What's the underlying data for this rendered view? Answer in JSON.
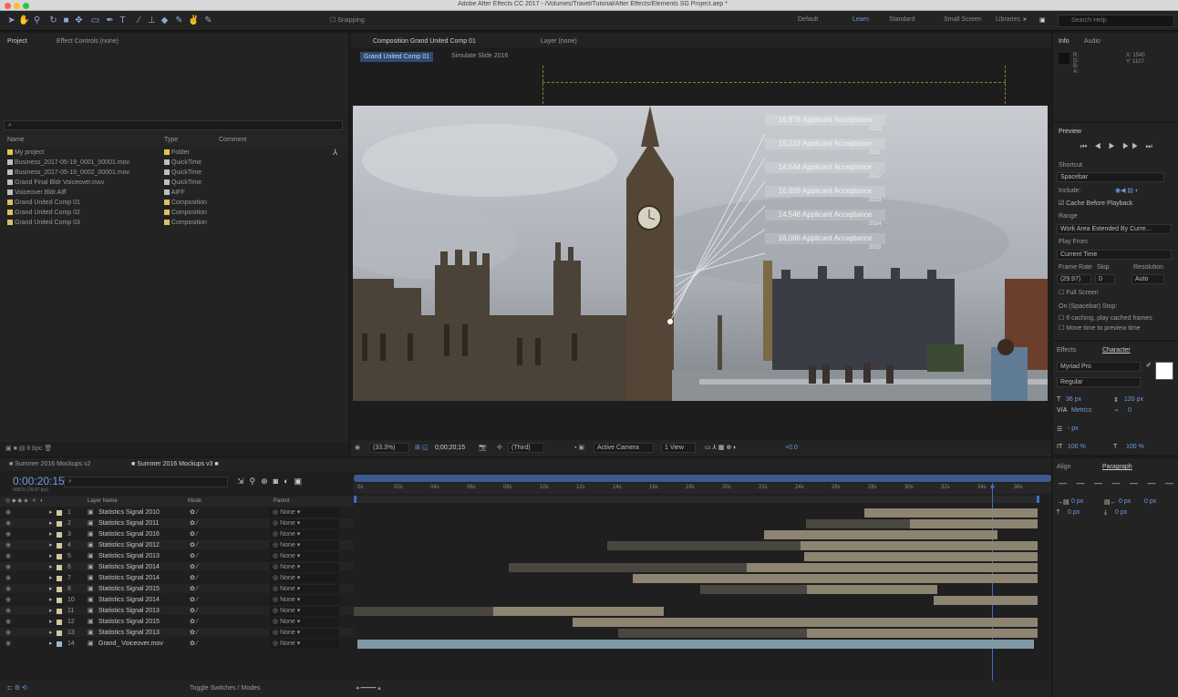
{
  "app_title": "Adobe After Effects CC 2017 - /Volumes/Travel/Tutorial/After Effects/Elements SG Project.aep *",
  "toolbar": {
    "snapping": "Snapping",
    "workspaces": [
      "Default",
      "Learn",
      "Standard",
      "Small Screen",
      "Libraries"
    ],
    "search_placeholder": "Search Help"
  },
  "project": {
    "tab_project": "Project",
    "tab_effects": "Effect Controls (none)",
    "search_placeholder": "⌕",
    "col_name": "Name",
    "col_type": "Type",
    "col_comment": "Comment",
    "items": [
      {
        "name": "My project",
        "type": "Folder",
        "color": "#e6c64a"
      },
      {
        "name": "Business_2017-05-19_0001_00001.mov",
        "type": "QuickTime",
        "color": "#bfbfbf"
      },
      {
        "name": "Business_2017-05-19_0002_00001.mov",
        "type": "QuickTime",
        "color": "#bfbfbf"
      },
      {
        "name": "Grand Final Bldr Voiceover.mov",
        "type": "QuickTime",
        "color": "#bfbfbf"
      },
      {
        "name": "Voiceover Bldr.Aiff",
        "type": "AIFF",
        "color": "#bfbfbf"
      },
      {
        "name": "Grand United Comp 01",
        "type": "Composition",
        "color": "#e0c060"
      },
      {
        "name": "Grand United Comp 02",
        "type": "Composition",
        "color": "#e0c060"
      },
      {
        "name": "Grand United Comp 03",
        "type": "Composition",
        "color": "#e0c060"
      }
    ],
    "bpc": "8 bpc"
  },
  "comp": {
    "tab": "Composition Grand United Comp 01",
    "layer_tab": "Layer (none)",
    "breadcrumb_1": "Grand United Comp 01",
    "breadcrumb_2": "Simulate Slide 2016",
    "callouts": [
      {
        "text": "16,978 Applicant Acceptance",
        "year": "2010"
      },
      {
        "text": "15,232 Applicant Acceptance",
        "year": "2011"
      },
      {
        "text": "14,644 Applicant Acceptance",
        "year": "2012"
      },
      {
        "text": "16,659 Applicant Acceptance",
        "year": "2013"
      },
      {
        "text": "14,546 Applicant Acceptance",
        "year": "2014"
      },
      {
        "text": "16,086 Applicant Acceptance",
        "year": "2015"
      }
    ],
    "zoom": "(33.3%)",
    "timecode": "0;00;20;15",
    "resolution": "(Third)",
    "camera": "Active Camera",
    "views": "1 View",
    "exposure": "+0.0"
  },
  "info": {
    "tab_info": "Info",
    "tab_audio": "Audio",
    "r": "R:",
    "g": "G:",
    "b": "B:",
    "a": "A:",
    "x": "X: 1540",
    "y": "Y: 1107"
  },
  "preview": {
    "title": "Preview",
    "shortcut_label": "Shortcut",
    "shortcut_value": "Spacebar",
    "include_label": "Include:",
    "cache_label": "Cache Before Playback",
    "range_label": "Range",
    "range_value": "Work Area Extended By Curre...",
    "play_from_label": "Play From",
    "play_from_value": "Current Time",
    "frame_rate_label": "Frame Rate",
    "skip_label": "Skip",
    "resolution_label": "Resolution",
    "frame_rate_value": "(29.97)",
    "skip_value": "0",
    "resolution_value": "Auto",
    "full_screen": "Full Screen",
    "on_stop": "On (Spacebar) Stop:",
    "if_caching": "If caching, play cached frames",
    "move_time": "Move time to preview time"
  },
  "character": {
    "tab_effects": "Effects",
    "tab_character": "Character",
    "font": "Myriad Pro",
    "style": "Regular",
    "size": "36 px",
    "leading": "120 px",
    "tracking": "Metrics",
    "kerning": "0",
    "stroke": "- px",
    "scale_v": "100 %",
    "scale_h": "100 %"
  },
  "paragraph": {
    "tab_align": "Align",
    "tab_paragraph": "Paragraph",
    "indent_1": "0 px",
    "indent_2": "0 px",
    "indent_3": "0 px",
    "space_1": "0 px",
    "space_2": "0 px"
  },
  "timeline": {
    "tab1": "Summer 2016 Mockups v2",
    "tab2": "Summer 2016 Mockups v3",
    "timecode": "0:00:20:15",
    "fps": "00615 (29.97 fps)",
    "col_layer": "Layer Name",
    "col_switches": "Mode",
    "col_parent": "Parent",
    "ruler": [
      "0s",
      "02s",
      "04s",
      "06s",
      "08s",
      "10s",
      "12s",
      "14s",
      "16s",
      "18s",
      "20s",
      "22s",
      "24s",
      "26s",
      "28s",
      "30s",
      "32s",
      "34s",
      "36s"
    ],
    "layers": [
      {
        "num": "1",
        "name": "Statistics Signal 2010",
        "color": "#d0c9a0",
        "parent": "None"
      },
      {
        "num": "2",
        "name": "Statistics Signal 2011",
        "color": "#d0c9a0",
        "parent": "None"
      },
      {
        "num": "3",
        "name": "Statistics Signal 2016",
        "color": "#d0c9a0",
        "parent": "None"
      },
      {
        "num": "4",
        "name": "Statistics Signal 2012",
        "color": "#d0c9a0",
        "parent": "None"
      },
      {
        "num": "5",
        "name": "Statistics Signal 2013",
        "color": "#d0c9a0",
        "parent": "None"
      },
      {
        "num": "6",
        "name": "Statistics Signal 2014",
        "color": "#d0c9a0",
        "parent": "None"
      },
      {
        "num": "7",
        "name": "Statistics Signal 2014",
        "color": "#d0c9a0",
        "parent": "None"
      },
      {
        "num": "8",
        "name": "Statistics Signal 2015",
        "color": "#d0c9a0",
        "parent": "None"
      },
      {
        "num": "10",
        "name": "Statistics Signal 2014",
        "color": "#d0c9a0",
        "parent": "None"
      },
      {
        "num": "11",
        "name": "Statistics Signal 2013",
        "color": "#d0c9a0",
        "parent": "None"
      },
      {
        "num": "12",
        "name": "Statistics Signal 2015",
        "color": "#d0c9a0",
        "parent": "None"
      },
      {
        "num": "13",
        "name": "Statistics Signal 2013",
        "color": "#d0c9a0",
        "parent": "None"
      },
      {
        "num": "14",
        "name": "Grand_ Voiceover.mov",
        "color": "#9cb8c8",
        "parent": "None"
      }
    ],
    "footer": "Toggle Switches / Modes"
  }
}
